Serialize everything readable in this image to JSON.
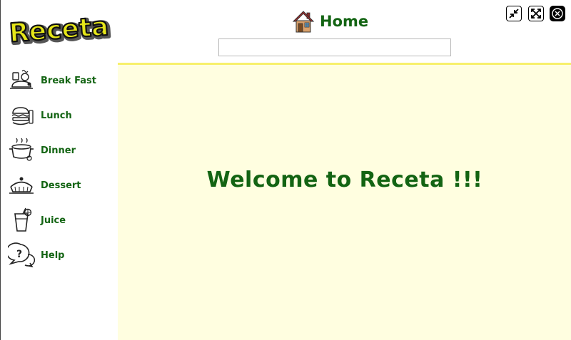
{
  "app": {
    "logo_text": "Receta"
  },
  "header": {
    "title": "Home",
    "search": {
      "value": "",
      "placeholder": ""
    }
  },
  "window_controls": [
    "restore-icon",
    "maximize-icon",
    "close-icon"
  ],
  "sidebar": {
    "items": [
      {
        "label": "Break Fast",
        "icon": "breakfast-icon"
      },
      {
        "label": "Lunch",
        "icon": "lunch-icon"
      },
      {
        "label": "Dinner",
        "icon": "dinner-icon"
      },
      {
        "label": "Dessert",
        "icon": "dessert-icon"
      },
      {
        "label": "Juice",
        "icon": "juice-icon"
      },
      {
        "label": "Help",
        "icon": "help-icon"
      }
    ]
  },
  "main": {
    "welcome_text": "Welcome to Receta !!!"
  },
  "colors": {
    "accent_text": "#136413",
    "content_bg": "#fffee0",
    "content_border": "#f7f06b",
    "logo_fill": "#e5e619"
  }
}
